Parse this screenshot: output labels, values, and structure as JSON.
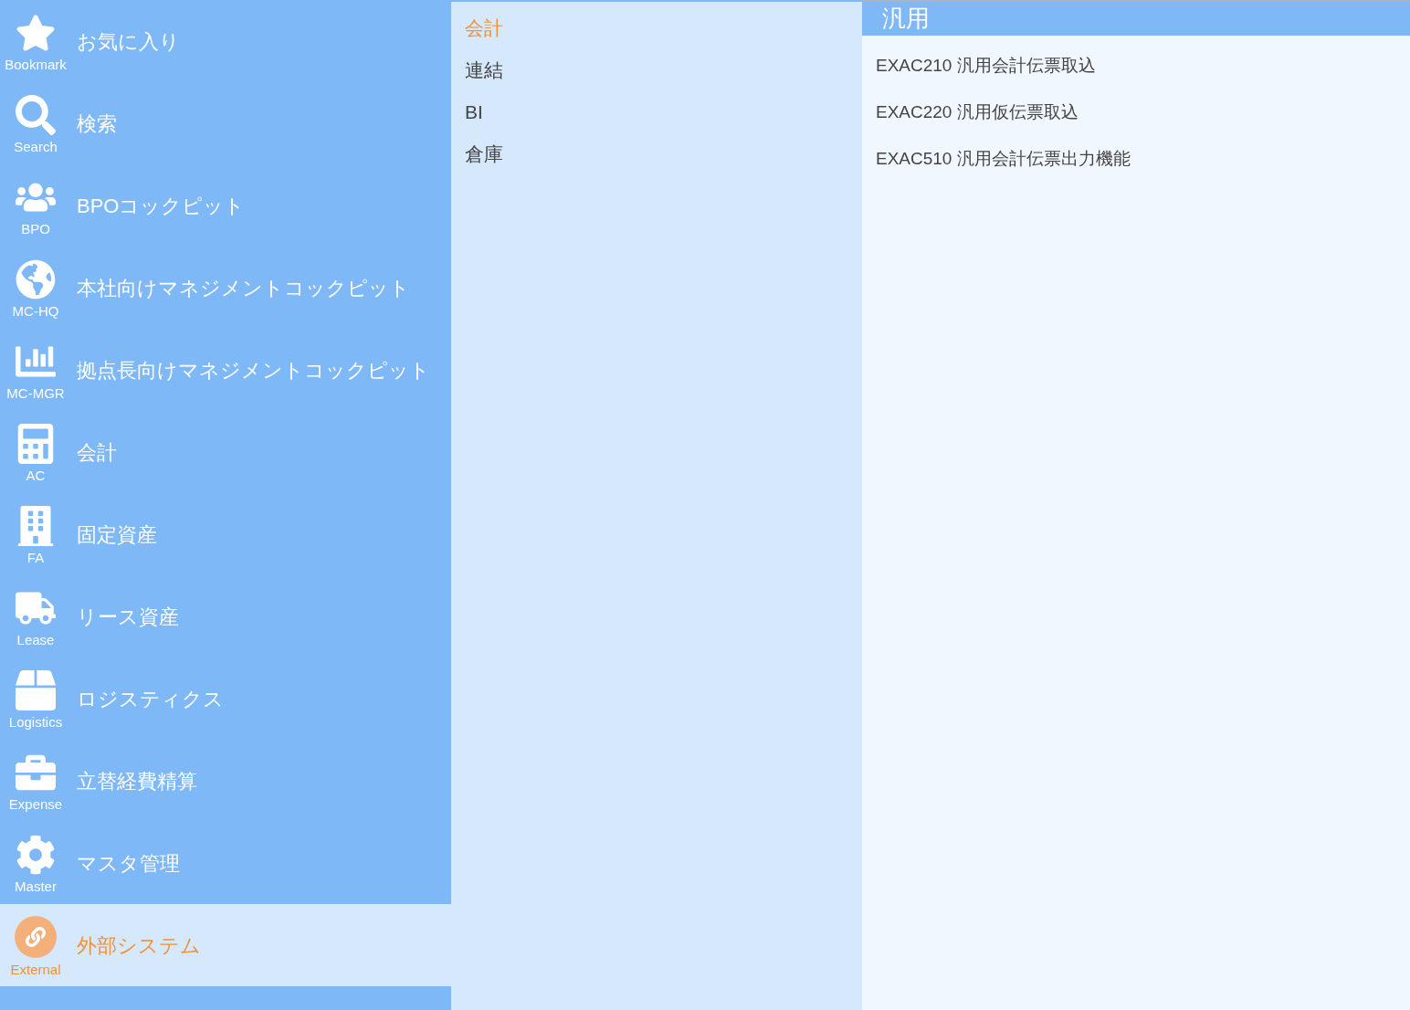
{
  "sidebar": {
    "items": [
      {
        "label": "お気に入り",
        "caption": "Bookmark",
        "selected": false
      },
      {
        "label": "検索",
        "caption": "Search",
        "selected": false
      },
      {
        "label": "BPOコックピット",
        "caption": "BPO",
        "selected": false
      },
      {
        "label": "本社向けマネジメントコックピット",
        "caption": "MC-HQ",
        "selected": false
      },
      {
        "label": "拠点長向けマネジメントコックピット",
        "caption": "MC-MGR",
        "selected": false
      },
      {
        "label": "会計",
        "caption": "AC",
        "selected": false
      },
      {
        "label": "固定資産",
        "caption": "FA",
        "selected": false
      },
      {
        "label": "リース資産",
        "caption": "Lease",
        "selected": false
      },
      {
        "label": "ロジスティクス",
        "caption": "Logistics",
        "selected": false
      },
      {
        "label": "立替経費精算",
        "caption": "Expense",
        "selected": false
      },
      {
        "label": "マスタ管理",
        "caption": "Master",
        "selected": false
      },
      {
        "label": "外部システム",
        "caption": "External",
        "selected": true
      }
    ]
  },
  "categories": [
    {
      "label": "会計",
      "selected": true
    },
    {
      "label": "連結",
      "selected": false
    },
    {
      "label": "BI",
      "selected": false
    },
    {
      "label": "倉庫",
      "selected": false
    }
  ],
  "panel": {
    "title": "汎用",
    "items": [
      "EXAC210 汎用会計伝票取込",
      "EXAC220 汎用仮伝票取込",
      "EXAC510 汎用会計伝票出力機能"
    ]
  }
}
